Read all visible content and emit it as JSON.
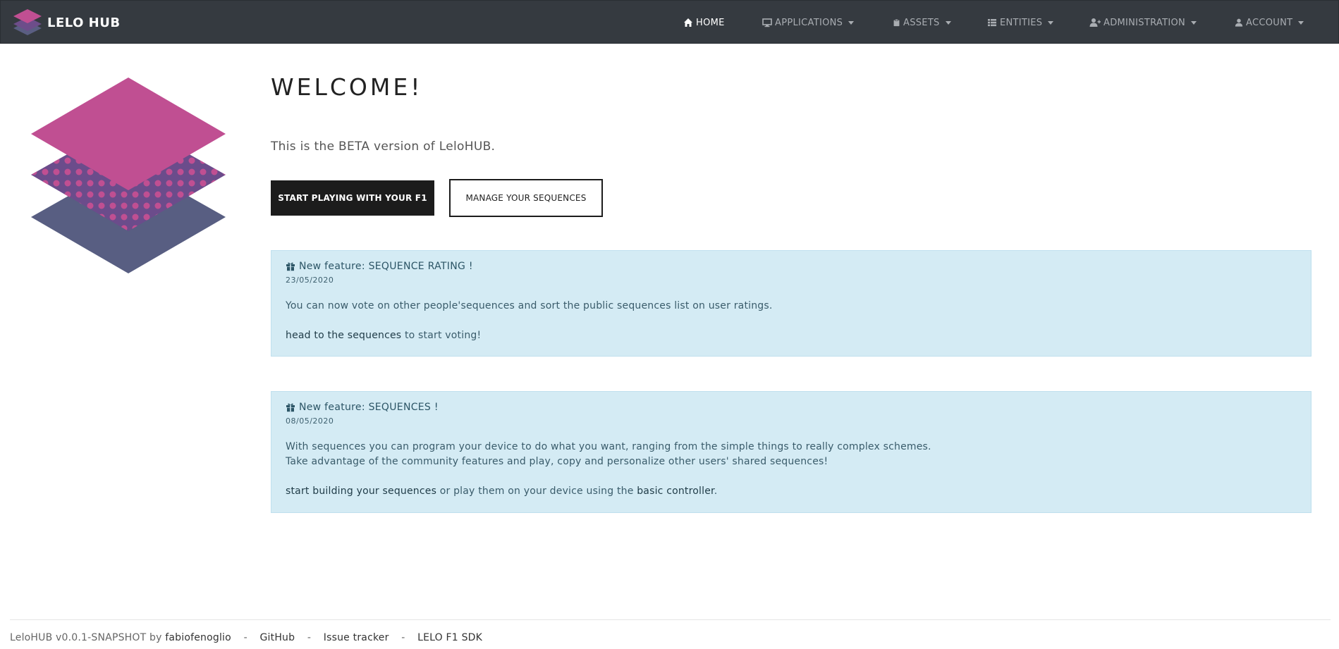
{
  "navbar": {
    "brand": "LELO HUB",
    "items": [
      {
        "label": "HOME",
        "icon": "home-icon",
        "active": true
      },
      {
        "label": "APPLICATIONS",
        "icon": "desktop-icon"
      },
      {
        "label": "ASSETS",
        "icon": "clipboard-icon"
      },
      {
        "label": "ENTITIES",
        "icon": "list-icon"
      },
      {
        "label": "ADMINISTRATION",
        "icon": "user-plus-icon"
      },
      {
        "label": "ACCOUNT",
        "icon": "user-icon"
      }
    ]
  },
  "hero": {
    "title": "WELCOME!",
    "subtitle": "This is the BETA version of LeloHUB.",
    "primary_button": "START PLAYING WITH YOUR F1",
    "secondary_button": "MANAGE YOUR SEQUENCES"
  },
  "news": [
    {
      "title": "New feature: SEQUENCE RATING !",
      "date": "23/05/2020",
      "text": "You can now vote on other people'sequences and sort the public sequences list on user ratings.",
      "cta_link": "head to the sequences",
      "cta_rest": " to start voting!"
    },
    {
      "title": "New feature: SEQUENCES !",
      "date": "08/05/2020",
      "text_line1": "With sequences you can program your device to do what you want, ranging from the simple things to really complex schemes.",
      "text_line2": "Take advantage of the community features and play, copy and personalize other users' shared sequences!",
      "cta_link1": "start building your sequences",
      "cta_mid": " or play them on your device using the ",
      "cta_link2": "basic controller",
      "cta_end": "."
    }
  ],
  "footer": {
    "version_text": "LeloHUB v0.0.1-SNAPSHOT by ",
    "author": "fabiofenoglio",
    "separator": "-",
    "links": [
      "GitHub",
      "Issue tracker",
      "LELO F1 SDK"
    ]
  },
  "colors": {
    "navbar_bg": "#353a40",
    "logo_pink": "#c04f92",
    "logo_purple": "#6d4d8a",
    "logo_slate": "#5a5e82",
    "alert_bg": "#d4ebf4",
    "primary_button_bg": "#1c1c1c"
  }
}
